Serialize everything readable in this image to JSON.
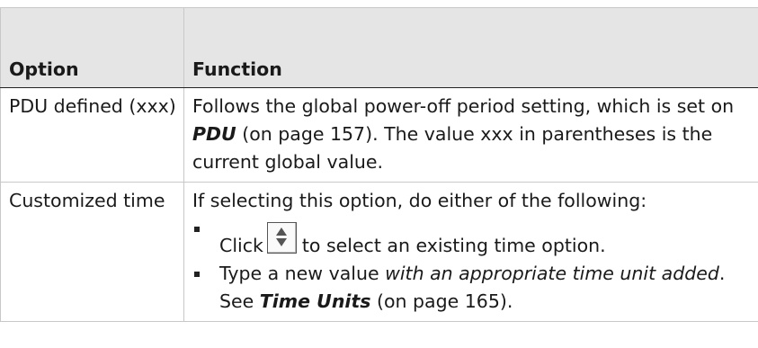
{
  "table": {
    "headers": [
      "Option",
      "Function"
    ],
    "rows": [
      {
        "option": "PDU defined (xxx)",
        "fn_pre": "Follows the global power-off period setting, which is set on ",
        "fn_ref": "PDU",
        "fn_post": " (on page 157). The value xxx in parentheses is the current global value."
      },
      {
        "option": "Customized time",
        "intro": "If selecting this option, do either of the following:",
        "bullet1_pre": "Click",
        "bullet1_post": "to select an existing time option.",
        "bullet2_pre": "Type a new value ",
        "bullet2_em": "with an appropriate time unit added",
        "bullet2_mid": ". See ",
        "bullet2_ref": "Time Units",
        "bullet2_post": " (on page 165)."
      }
    ]
  },
  "icons": {
    "spinner": "up-down-spinner-icon"
  }
}
